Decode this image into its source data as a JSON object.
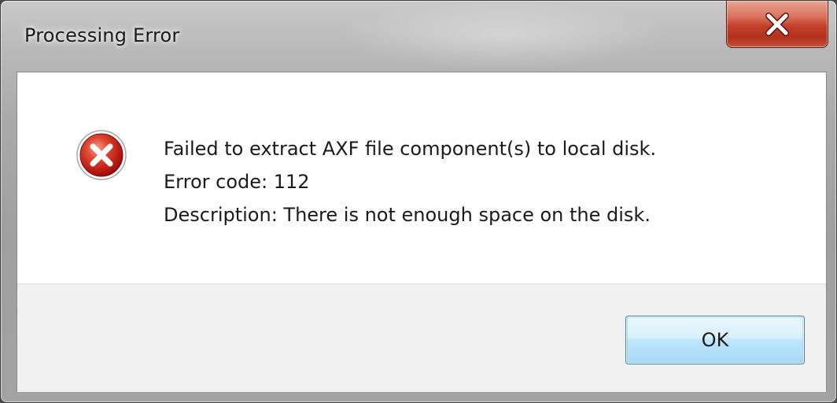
{
  "window": {
    "title": "Processing Error",
    "close_icon": "close-x-icon"
  },
  "dialog": {
    "icon": "error-icon",
    "message_lines": [
      "Failed to extract AXF file component(s) to local disk.",
      "Error code: 112",
      "Description: There is not enough space on the disk."
    ],
    "ok_label": "OK"
  },
  "colors": {
    "close_button_red": "#c2402a",
    "error_icon_red": "#c9211e",
    "ok_button_border": "#3c7fb1",
    "footer_bg": "#f0f0f0"
  }
}
